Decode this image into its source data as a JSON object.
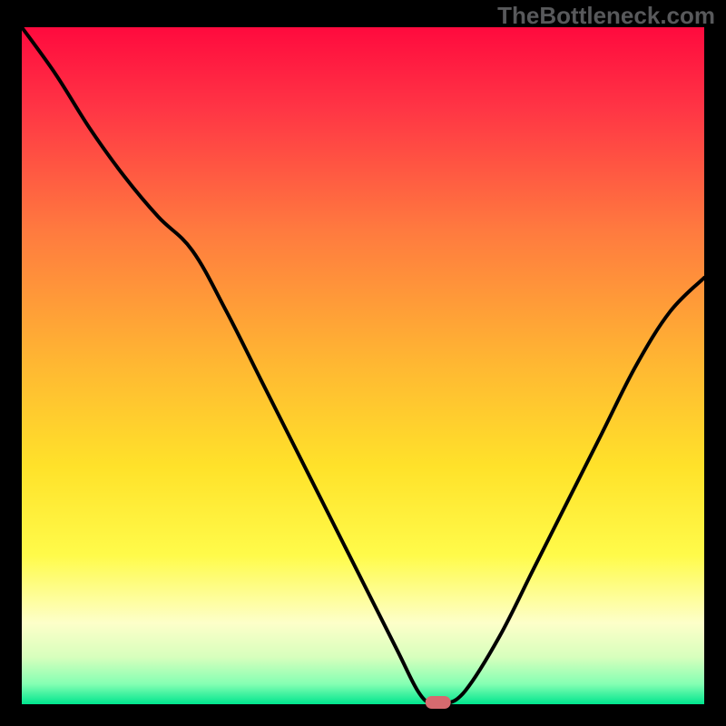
{
  "watermark": "TheBottleneck.com",
  "chart_data": {
    "type": "line",
    "title": "",
    "xlabel": "",
    "ylabel": "",
    "xlim": [
      0,
      100
    ],
    "ylim": [
      0,
      100
    ],
    "x": [
      0,
      5,
      10,
      15,
      20,
      25,
      30,
      35,
      40,
      45,
      50,
      55,
      58,
      60,
      62,
      65,
      70,
      75,
      80,
      85,
      90,
      95,
      100
    ],
    "values": [
      100,
      93,
      85,
      78,
      72,
      67,
      58,
      48,
      38,
      28,
      18,
      8,
      2,
      0,
      0,
      2,
      10,
      20,
      30,
      40,
      50,
      58,
      63
    ],
    "marker": {
      "x": 61,
      "y": 0
    },
    "background_gradient": {
      "stops": [
        {
          "offset": 0.0,
          "color": "#ff0a3e"
        },
        {
          "offset": 0.12,
          "color": "#ff3545"
        },
        {
          "offset": 0.3,
          "color": "#ff7a3f"
        },
        {
          "offset": 0.5,
          "color": "#ffb832"
        },
        {
          "offset": 0.65,
          "color": "#ffe22a"
        },
        {
          "offset": 0.78,
          "color": "#fffb4a"
        },
        {
          "offset": 0.88,
          "color": "#fdffc9"
        },
        {
          "offset": 0.93,
          "color": "#d8ffbd"
        },
        {
          "offset": 0.97,
          "color": "#85ffb3"
        },
        {
          "offset": 1.0,
          "color": "#00e58e"
        }
      ]
    },
    "frame_color": "#000000",
    "line_color": "#000000",
    "marker_color": "#d66a6f"
  }
}
